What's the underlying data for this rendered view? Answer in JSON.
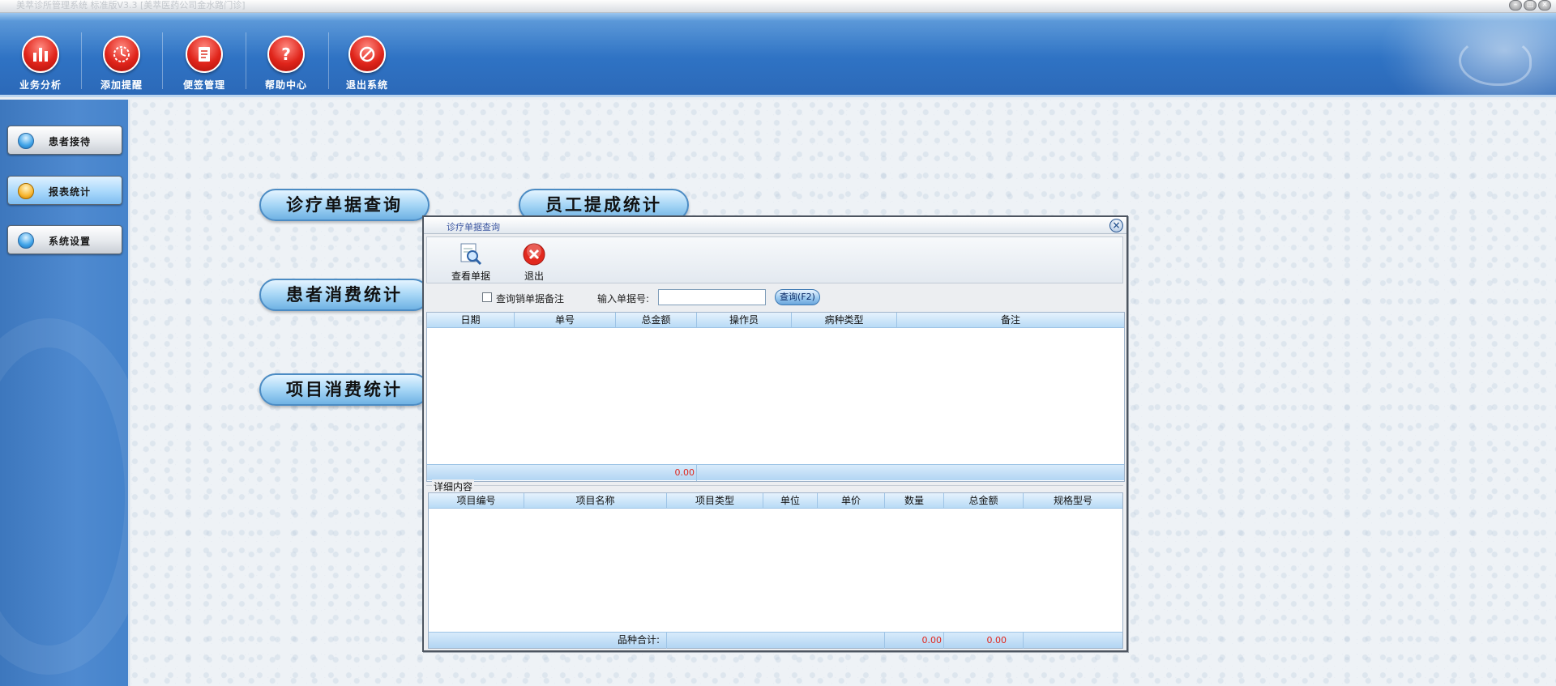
{
  "window": {
    "title": "美萃诊所管理系统 标准版V3.3 [美萃医药公司金水路门诊]",
    "controls": [
      "minimize",
      "maximize",
      "close"
    ]
  },
  "toolbar": {
    "items": [
      {
        "label": "业务分析",
        "icon": "bar-chart-icon"
      },
      {
        "label": "添加提醒",
        "icon": "clock-icon"
      },
      {
        "label": "便签管理",
        "icon": "notepad-icon"
      },
      {
        "label": "帮助中心",
        "icon": "help-icon"
      },
      {
        "label": "退出系统",
        "icon": "no-entry-icon"
      }
    ]
  },
  "sidebar": {
    "items": [
      {
        "label": "患者接待",
        "active": false
      },
      {
        "label": "报表统计",
        "active": true
      },
      {
        "label": "系统设置",
        "active": false
      }
    ]
  },
  "reports": {
    "buttons": [
      "诊疗单据查询",
      "员工提成统计",
      "患者消费统计",
      "项目消费统计"
    ]
  },
  "dialog": {
    "title": "诊疗单据查询",
    "close_symbol": "×",
    "actions": [
      {
        "label": "查看单据",
        "icon": "magnifier-doc-icon"
      },
      {
        "label": "退出",
        "icon": "exit-red-icon"
      }
    ],
    "filter": {
      "checkbox_label": "查询销单据备注",
      "checkbox_checked": false,
      "bill_no_label": "输入单据号:",
      "bill_no_value": "",
      "query_button": "查询(F2)"
    },
    "bills_table": {
      "columns": [
        "日期",
        "单号",
        "总金额",
        "操作员",
        "病种类型",
        "备注"
      ],
      "rows": [],
      "footer_total": "0.00"
    },
    "detail_section_label": "详细内容",
    "detail_table": {
      "columns": [
        "项目编号",
        "项目名称",
        "项目类型",
        "单位",
        "单价",
        "数量",
        "总金额",
        "规格型号"
      ],
      "rows": [],
      "footer_label": "品种合计:",
      "footer_quantity": "0.00",
      "footer_amount": "0.00"
    }
  },
  "colors": {
    "banner": "#2f73c4",
    "sidebar": "#4583cb",
    "accent_red": "#e0261c",
    "grid_header": "#b8dbf6"
  }
}
